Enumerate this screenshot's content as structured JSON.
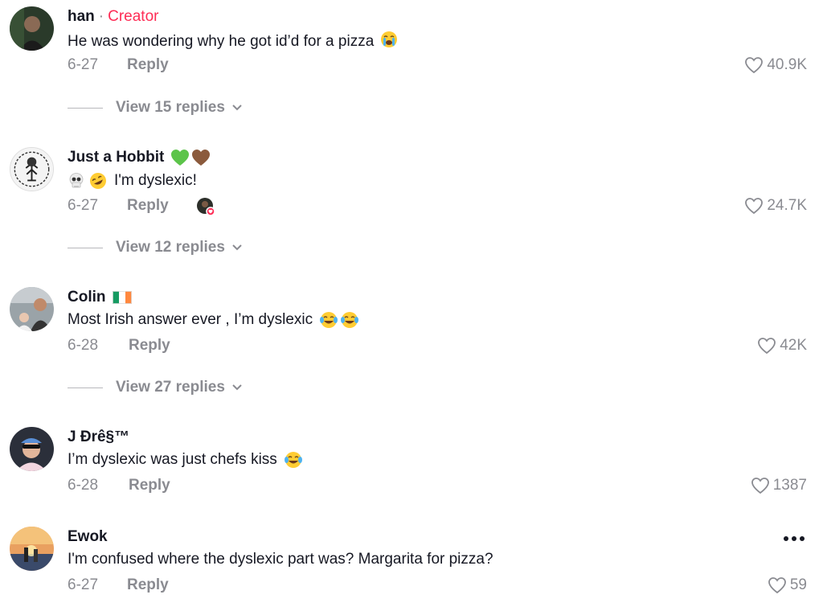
{
  "comments": [
    {
      "username": "han",
      "separator": "·",
      "badge": "Creator",
      "text": "He was wondering why he got id’d for a pizza",
      "date": "6-27",
      "reply_label": "Reply",
      "likes": "40.9K",
      "view_replies": "View 15 replies"
    },
    {
      "username": "Just a Hobbit",
      "text": "I'm dyslexic!",
      "date": "6-27",
      "reply_label": "Reply",
      "likes": "24.7K",
      "view_replies": "View 12 replies"
    },
    {
      "username": "Colin",
      "text": "Most Irish answer ever , I’m dyslexic",
      "date": "6-28",
      "reply_label": "Reply",
      "likes": "42K",
      "view_replies": "View 27 replies"
    },
    {
      "username": "J Ðrê§™",
      "text": "I’m dyslexic was just chefs kiss",
      "date": "6-28",
      "reply_label": "Reply",
      "likes": "1387"
    },
    {
      "username": "Ewok",
      "text": "I'm confused where the dyslexic part was? Margarita for pizza?",
      "date": "6-27",
      "reply_label": "Reply",
      "likes": "59"
    }
  ],
  "colors": {
    "creator_badge": "#fe2c55",
    "muted_text": "#8a8b91",
    "primary_text": "#161823"
  },
  "icons": [
    "heart-outline-icon",
    "chevron-down-icon",
    "more-options-icon",
    "crying-face-emoji",
    "skull-emoji",
    "rofl-emoji",
    "green-heart-emoji",
    "brown-heart-emoji",
    "ireland-flag-emoji",
    "tears-of-joy-emoji"
  ]
}
